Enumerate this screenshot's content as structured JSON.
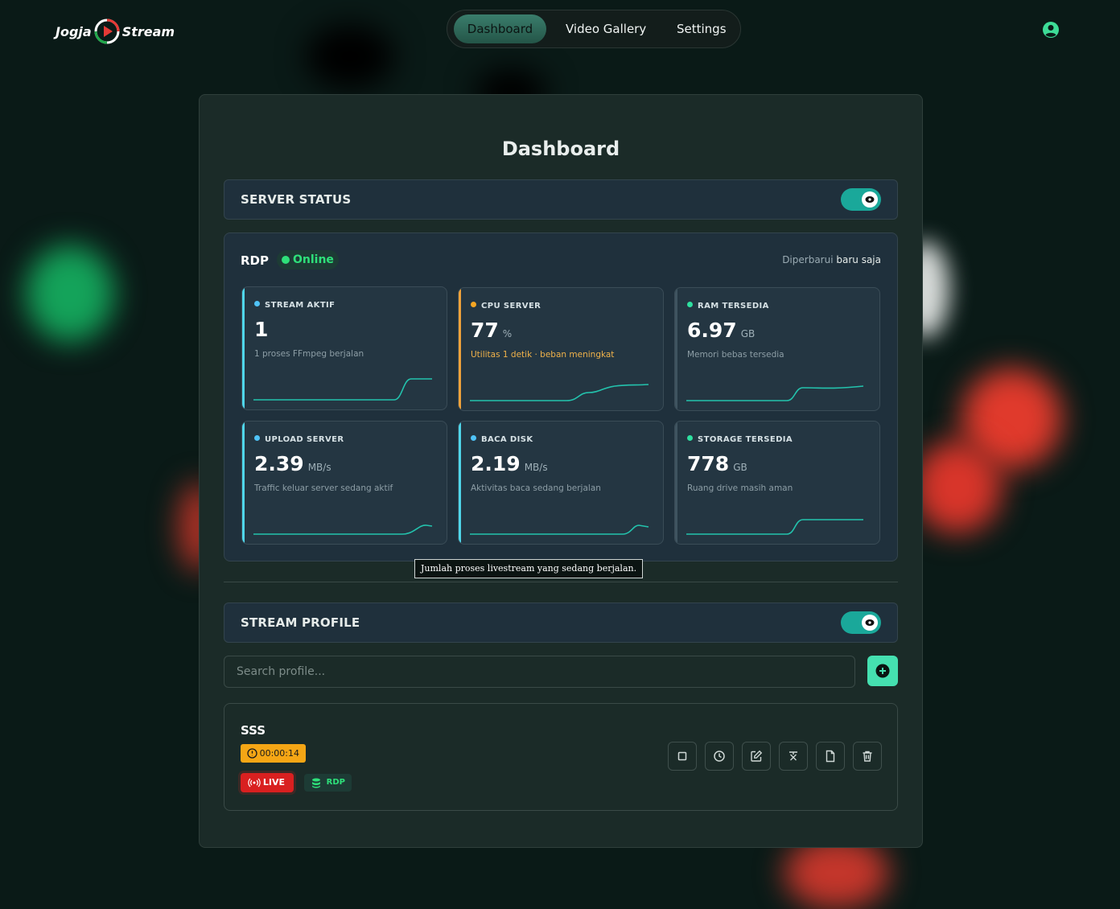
{
  "brand": {
    "part1": "Jogja",
    "part2": "Stream"
  },
  "nav": {
    "items": [
      {
        "label": "Dashboard"
      },
      {
        "label": "Video Gallery"
      },
      {
        "label": "Settings"
      }
    ]
  },
  "page": {
    "title": "Dashboard"
  },
  "server_status": {
    "label": "SERVER STATUS",
    "toggle_on": true
  },
  "rdp": {
    "title": "RDP",
    "status": "Online",
    "updated_label": "Diperbarui",
    "updated_value": "baru saja",
    "metrics": [
      {
        "label": "STREAM AKTIF",
        "value": "1",
        "unit": "",
        "desc": "1 proses FFmpeg berjalan",
        "accent": "#4fd6ea",
        "dot": "#4fc3f7"
      },
      {
        "label": "CPU SERVER",
        "value": "77",
        "unit": "%",
        "desc": "Utilitas 1 detik · beban meningkat",
        "accent": "#f0a23a",
        "dot": "#f5a623"
      },
      {
        "label": "RAM TERSEDIA",
        "value": "6.97",
        "unit": "GB",
        "desc": "Memori bebas tersedia",
        "accent": "#3f5460",
        "dot": "#2ee0a0"
      },
      {
        "label": "UPLOAD SERVER",
        "value": "2.39",
        "unit": "MB/s",
        "desc": "Traffic keluar server sedang aktif",
        "accent": "#4fd6ea",
        "dot": "#4fc3f7"
      },
      {
        "label": "BACA DISK",
        "value": "2.19",
        "unit": "MB/s",
        "desc": "Aktivitas baca sedang berjalan",
        "accent": "#4fd6ea",
        "dot": "#4fc3f7"
      },
      {
        "label": "STORAGE TERSEDIA",
        "value": "778",
        "unit": "GB",
        "desc": "Ruang drive masih aman",
        "accent": "#3f5460",
        "dot": "#2ee0a0"
      }
    ],
    "tooltip": "Jumlah proses livestream yang sedang berjalan."
  },
  "stream_profile": {
    "label": "STREAM PROFILE",
    "toggle_on": true,
    "search": {
      "placeholder": "Search profile...",
      "value": ""
    },
    "add_button": "add-icon",
    "profiles": [
      {
        "name": "SSS",
        "timer": "00:00:14",
        "live_label": "LIVE",
        "tag_label": "RDP",
        "actions": [
          "stop-icon",
          "schedule-icon",
          "edit-icon",
          "transform-icon",
          "file-icon",
          "trash-icon"
        ]
      }
    ]
  },
  "colors": {
    "accent": "#1aa89a",
    "live": "#d92020",
    "timer": "#f5a615",
    "online": "#2ee07a",
    "add_button": "#45e0b0"
  }
}
